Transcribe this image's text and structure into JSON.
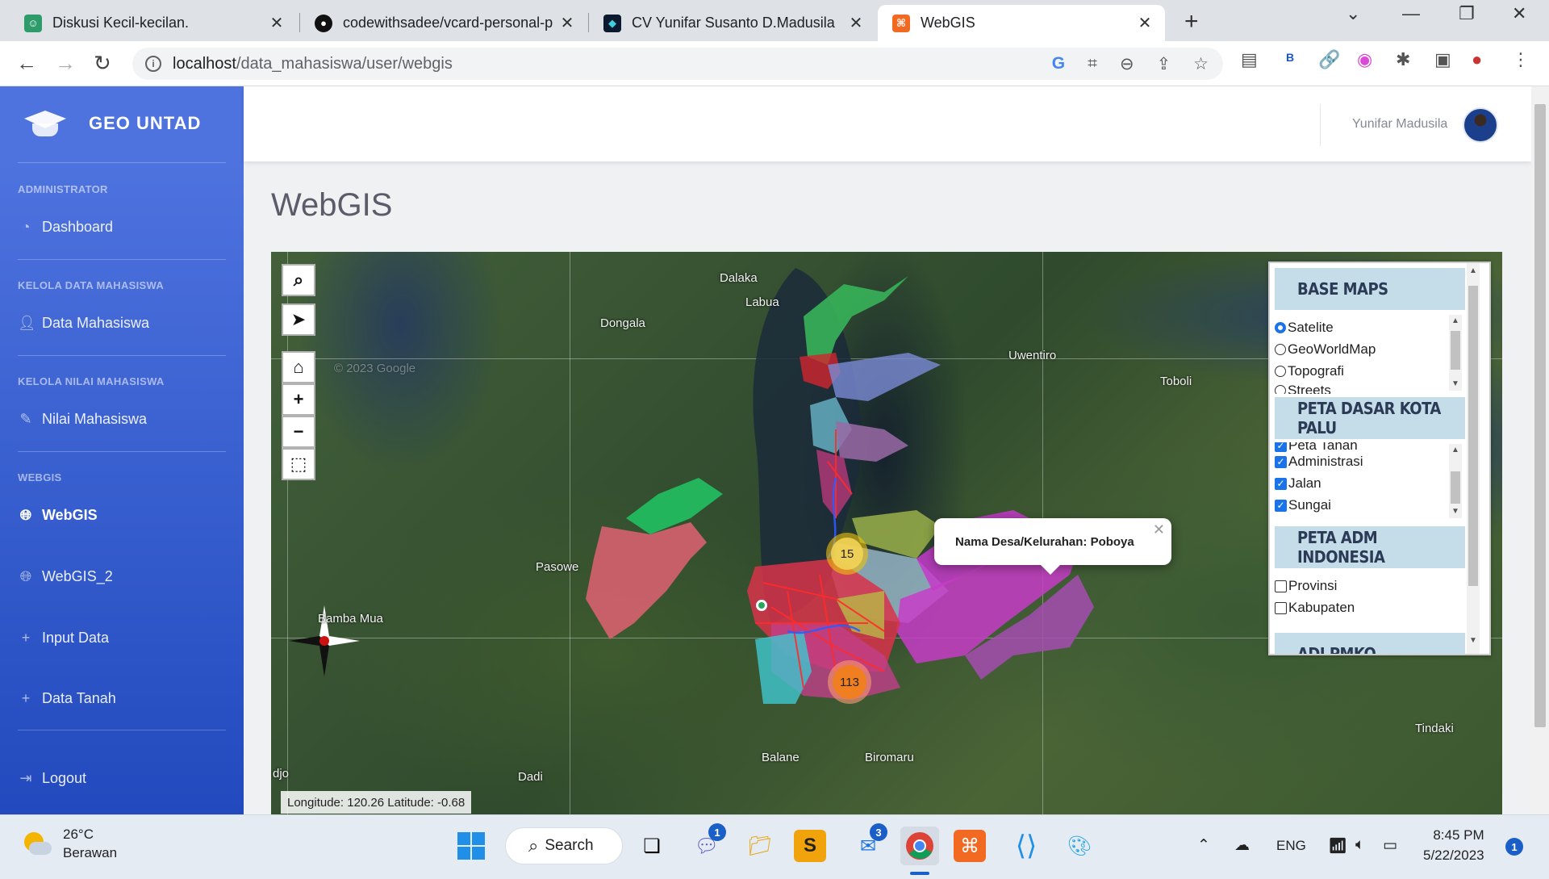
{
  "browser": {
    "tabs": [
      {
        "title": "Diskusi Kecil-kecilan.",
        "icon": "chat-icon",
        "color": "#2e9c6a"
      },
      {
        "title": "codewithsadee/vcard-personal-p",
        "icon": "github-icon",
        "color": "#111111"
      },
      {
        "title": "CV Yunifar Susanto D.Madusila",
        "icon": "cv-logo-icon",
        "color": "#0b1a2e"
      },
      {
        "title": "WebGIS",
        "icon": "xampp-icon",
        "color": "#f26a21"
      }
    ],
    "url_host": "localhost",
    "url_path": "/data_mahasiswa/user/webgis"
  },
  "sidebar": {
    "brand": "GEO UNTAD",
    "sections": {
      "admin": "ADMINISTRATOR",
      "kelola_mahasiswa": "KELOLA DATA MAHASISWA",
      "kelola_nilai": "KELOLA NILAI MAHASISWA",
      "webgis": "WEBGIS"
    },
    "items": {
      "dashboard": "Dashboard",
      "data_mahasiswa": "Data Mahasiswa",
      "nilai_mahasiswa": "Nilai Mahasiswa",
      "webgis": "WebGIS",
      "webgis2": "WebGIS_2",
      "input_data": "Input Data",
      "data_tanah": "Data Tanah",
      "logout": "Logout"
    }
  },
  "topbar": {
    "user_name": "Yunifar Madusila"
  },
  "page": {
    "title": "WebGIS"
  },
  "map": {
    "place_labels": {
      "dalaka": "Dalaka",
      "labua": "Labua",
      "dongala": "Dongala",
      "uwentiro": "Uwentiro",
      "toboli": "Toboli",
      "pasowe": "Pasowe",
      "bamba_mua": "Bamba Mua",
      "balane": "Balane",
      "biromaru": "Biromaru",
      "dadi": "Dadi",
      "tindaki": "Tindaki",
      "djo": "djo"
    },
    "watermark": "© 2023 Google",
    "clusters": {
      "north": "15",
      "south": "113"
    },
    "popup_text": "Nama Desa/Kelurahan: Poboya",
    "coords_text": "Longitude: 120.26 Latitude: -0.68",
    "layer_panel": {
      "base_maps_title": "BASE MAPS",
      "base_maps": [
        "Satelite",
        "GeoWorldMap",
        "Topografi",
        "Streets"
      ],
      "base_selected": "Satelite",
      "peta_dasar_title": "PETA DASAR KOTA PALU",
      "peta_dasar": [
        {
          "label": "Peta Tanah",
          "checked": true
        },
        {
          "label": "Administrasi",
          "checked": true
        },
        {
          "label": "Jalan",
          "checked": true
        },
        {
          "label": "Sungai",
          "checked": true
        }
      ],
      "peta_adm_title": "PETA ADM INDONESIA",
      "peta_adm": [
        {
          "label": "Provinsi",
          "checked": false
        },
        {
          "label": "Kabupaten",
          "checked": false
        }
      ],
      "next_title_partial": "ADI PMKO"
    }
  },
  "taskbar": {
    "weather_temp": "26°C",
    "weather_desc": "Berawan",
    "search_label": "Search",
    "lang": "ENG",
    "time": "8:45 PM",
    "date": "5/22/2023",
    "badges": {
      "teams": "1",
      "mail": "3",
      "notif": "1"
    }
  },
  "colors": {
    "sidebar_top": "#4e73df",
    "sidebar_bottom": "#224abe",
    "panel_header": "#c5dde9"
  }
}
